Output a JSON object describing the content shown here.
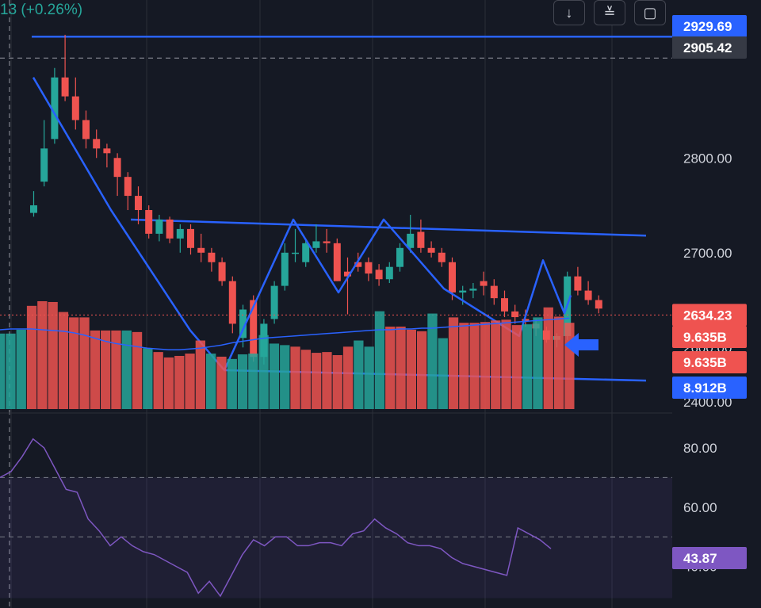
{
  "header": {
    "change_text": "13 (+0.26%)"
  },
  "toolbar": {
    "icons": [
      "download-arrow-icon",
      "collapse-icon",
      "fullscreen-icon"
    ],
    "glyphs": [
      "↓",
      "≚",
      "▢"
    ]
  },
  "colors": {
    "up": "#26a69a",
    "down": "#ef5350",
    "pattern": "#2962ff",
    "rsi": "#7e57c2",
    "bg": "#151924",
    "grid": "#2a2e39",
    "volume_ma": "#2962ff"
  },
  "chart_data": [
    {
      "type": "candlestick",
      "price_axis": {
        "ticks": [
          "2800.00",
          "2700.00",
          "2600.00",
          "2400.00"
        ],
        "ylim": [
          2540,
          2950
        ]
      },
      "badges": [
        {
          "label": "2929.69",
          "color": "#2962ff"
        },
        {
          "label": "2905.42",
          "color": "#363a45"
        },
        {
          "label": "2634.23",
          "color": "#ef5350"
        }
      ],
      "candles": [
        [
          2742,
          2765,
          2738,
          2750
        ],
        [
          2775,
          2840,
          2770,
          2810
        ],
        [
          2820,
          2895,
          2815,
          2885
        ],
        [
          2885,
          2930,
          2860,
          2865
        ],
        [
          2865,
          2885,
          2830,
          2840
        ],
        [
          2840,
          2850,
          2810,
          2820
        ],
        [
          2820,
          2830,
          2800,
          2810
        ],
        [
          2810,
          2815,
          2790,
          2805
        ],
        [
          2800,
          2805,
          2760,
          2780
        ],
        [
          2780,
          2785,
          2745,
          2760
        ],
        [
          2760,
          2770,
          2730,
          2745
        ],
        [
          2745,
          2750,
          2715,
          2720
        ],
        [
          2720,
          2740,
          2712,
          2735
        ],
        [
          2735,
          2738,
          2710,
          2715
        ],
        [
          2715,
          2730,
          2700,
          2725
        ],
        [
          2725,
          2730,
          2698,
          2705
        ],
        [
          2705,
          2720,
          2690,
          2700
        ],
        [
          2700,
          2705,
          2680,
          2690
        ],
        [
          2690,
          2695,
          2665,
          2670
        ],
        [
          2670,
          2675,
          2615,
          2625
        ],
        [
          2610,
          2645,
          2600,
          2640
        ],
        [
          2650,
          2655,
          2585,
          2590
        ],
        [
          2590,
          2630,
          2582,
          2625
        ],
        [
          2630,
          2670,
          2625,
          2665
        ],
        [
          2665,
          2710,
          2660,
          2700
        ],
        [
          2700,
          2725,
          2690,
          2700
        ],
        [
          2690,
          2715,
          2685,
          2710
        ],
        [
          2705,
          2730,
          2700,
          2712
        ],
        [
          2712,
          2725,
          2700,
          2710
        ],
        [
          2710,
          2715,
          2670,
          2670
        ],
        [
          2680,
          2695,
          2635,
          2675
        ],
        [
          2690,
          2700,
          2680,
          2685
        ],
        [
          2690,
          2695,
          2670,
          2678
        ],
        [
          2682,
          2688,
          2665,
          2672
        ],
        [
          2672,
          2690,
          2668,
          2685
        ],
        [
          2685,
          2710,
          2680,
          2705
        ],
        [
          2705,
          2740,
          2700,
          2720
        ],
        [
          2722,
          2735,
          2700,
          2705
        ],
        [
          2705,
          2712,
          2695,
          2700
        ],
        [
          2700,
          2705,
          2685,
          2690
        ],
        [
          2690,
          2695,
          2650,
          2658
        ],
        [
          2658,
          2665,
          2645,
          2660
        ],
        [
          2660,
          2668,
          2652,
          2662
        ],
        [
          2670,
          2680,
          2655,
          2665
        ],
        [
          2665,
          2672,
          2645,
          2652
        ],
        [
          2652,
          2660,
          2632,
          2638
        ],
        [
          2638,
          2645,
          2625,
          2632
        ],
        [
          2630,
          2640,
          2622,
          2628
        ],
        [
          2625,
          2630,
          2612,
          2620
        ],
        [
          2618,
          2622,
          2605,
          2608
        ],
        [
          2608,
          2615,
          2600,
          2612
        ],
        [
          2612,
          2680,
          2608,
          2675
        ],
        [
          2675,
          2685,
          2655,
          2660
        ],
        [
          2660,
          2670,
          2645,
          2650
        ],
        [
          2650,
          2655,
          2636,
          2641
        ]
      ],
      "drawn_lines": {
        "top_horizontal": [
          2929.69,
          2929.69
        ],
        "channel_upper": [
          2735,
          2718
        ],
        "channel_lower": [
          2576,
          2565
        ],
        "zigzag": [
          2885,
          2820,
          2745,
          2700,
          2618,
          2576,
          2735,
          2658,
          2735,
          2610,
          2692,
          2636,
          2655
        ]
      },
      "current_price": 2634.23
    },
    {
      "type": "volume",
      "badges": [
        {
          "label": "9.635B",
          "color": "#ef5350"
        },
        {
          "label": "9.635B",
          "color": "#ef5350"
        },
        {
          "label": "8.912B",
          "color": "#2962ff"
        }
      ],
      "values": [
        9.8,
        9.8,
        10.3,
        13.4,
        14.0,
        13.9,
        12.6,
        11.9,
        11.9,
        10.2,
        10.2,
        10.2,
        10.2,
        10.0,
        7.9,
        7.4,
        6.7,
        6.9,
        7.2,
        8.9,
        7.2,
        6.8,
        6.5,
        7.1,
        7.2,
        9.6,
        8.5,
        8.3,
        8.1,
        7.7,
        7.3,
        7.4,
        7.0,
        8.1,
        8.9,
        8.1,
        12.7,
        10.7,
        10.7,
        10.3,
        10.1,
        12.4,
        9.2,
        11.9,
        11.2,
        11.2,
        11.3,
        11.5,
        11.6,
        10.9,
        11.0,
        11.9,
        13.2,
        12.0,
        11.2
      ],
      "ma": [
        10.3,
        10.4,
        10.4,
        10.4,
        10.3,
        10.2,
        10.1,
        9.9,
        9.6,
        9.2,
        8.8,
        8.5,
        8.3,
        8.1,
        7.9,
        7.8,
        7.7,
        7.7,
        7.8,
        7.9,
        8.1,
        8.3,
        8.6,
        8.8,
        9.0,
        9.2,
        9.3,
        9.4,
        9.5,
        9.6,
        9.7,
        9.8,
        9.9,
        10.0,
        10.1,
        10.2,
        10.3,
        10.3,
        10.4,
        10.4,
        10.5,
        10.5,
        10.6,
        10.7,
        10.8,
        10.9,
        11.0,
        11.1,
        11.2,
        11.3,
        11.4,
        11.5,
        11.6,
        11.7,
        11.8
      ]
    },
    {
      "type": "line",
      "series": [
        {
          "values": [
            70,
            72,
            77,
            83,
            80,
            73,
            66,
            65,
            56,
            52,
            47,
            50,
            47,
            45,
            44,
            42,
            40,
            38,
            31,
            35,
            30,
            37,
            44,
            49,
            47,
            50,
            50,
            47,
            47,
            48,
            48,
            47,
            51,
            52,
            56,
            53,
            51,
            48,
            47,
            47,
            46,
            43,
            41,
            40,
            39,
            38,
            37,
            53,
            51,
            49,
            46
          ]
        }
      ],
      "rsi_axis": {
        "ticks": [
          "80.00",
          "60.00",
          "40.00"
        ],
        "ylim": [
          26,
          88
        ]
      },
      "badges": [
        {
          "label": "43.87",
          "color": "#7e57c2"
        }
      ],
      "band": [
        40,
        70
      ],
      "midline": 50
    }
  ]
}
